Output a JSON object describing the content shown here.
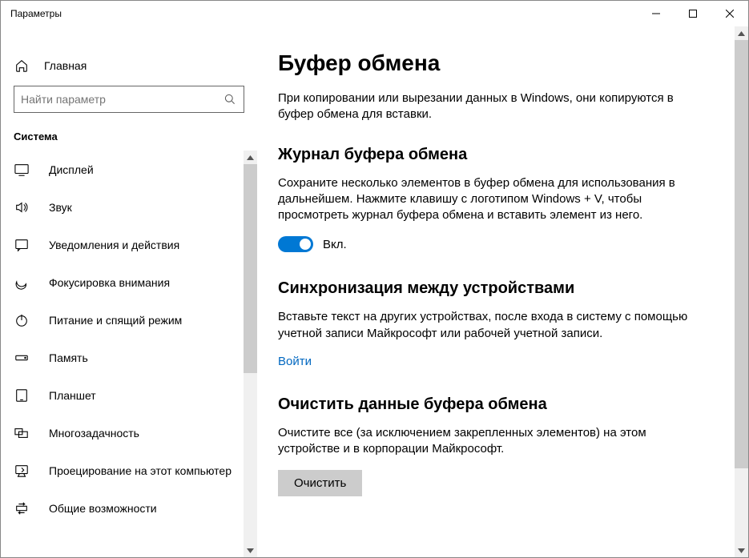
{
  "window": {
    "title": "Параметры"
  },
  "sidebar": {
    "home_label": "Главная",
    "search_placeholder": "Найти параметр",
    "section_label": "Система",
    "items": [
      {
        "label": "Дисплей"
      },
      {
        "label": "Звук"
      },
      {
        "label": "Уведомления и действия"
      },
      {
        "label": "Фокусировка внимания"
      },
      {
        "label": "Питание и спящий режим"
      },
      {
        "label": "Память"
      },
      {
        "label": "Планшет"
      },
      {
        "label": "Многозадачность"
      },
      {
        "label": "Проецирование на этот компьютер"
      },
      {
        "label": "Общие возможности"
      }
    ]
  },
  "content": {
    "title": "Буфер обмена",
    "intro": "При копировании или вырезании данных в Windows, они копируются в буфер обмена для вставки.",
    "sec1_head": "Журнал буфера обмена",
    "sec1_body": "Сохраните несколько элементов в буфер обмена для использования в дальнейшем. Нажмите клавишу с логотипом Windows + V, чтобы просмотреть журнал буфера обмена и вставить элемент из него.",
    "toggle_label": "Вкл.",
    "sec2_head": "Синхронизация между устройствами",
    "sec2_body": "Вставьте текст на других устройствах, после входа в систему с помощью учетной записи Майкрософт или рабочей учетной записи.",
    "signin": "Войти",
    "sec3_head": "Очистить данные буфера обмена",
    "sec3_body": "Очистите все (за исключением закрепленных элементов) на этом устройстве и в корпорации Майкрософт.",
    "clear_btn": "Очистить"
  }
}
